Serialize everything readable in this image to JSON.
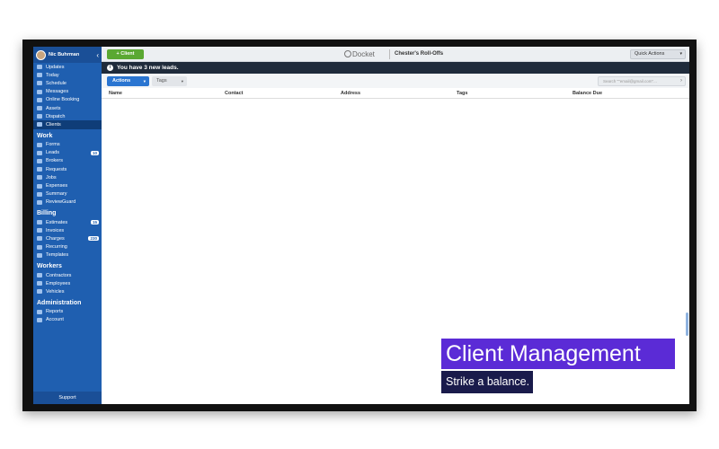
{
  "user": {
    "name": "Nic Buhrman"
  },
  "sidebar": {
    "main": [
      {
        "label": "Updates",
        "icon": "bell-icon"
      },
      {
        "label": "Today",
        "icon": "calendar-icon"
      },
      {
        "label": "Schedule",
        "icon": "calendar-icon"
      },
      {
        "label": "Messages",
        "icon": "chat-icon"
      },
      {
        "label": "Online Booking",
        "icon": "calendar-icon"
      },
      {
        "label": "Assets",
        "icon": "box-icon"
      },
      {
        "label": "Dispatch",
        "icon": "truck-icon"
      },
      {
        "label": "Clients",
        "icon": "users-icon"
      }
    ],
    "work_title": "Work",
    "work": [
      {
        "label": "Forms",
        "badge": ""
      },
      {
        "label": "Leads",
        "badge": "10"
      },
      {
        "label": "Brokers",
        "badge": ""
      },
      {
        "label": "Requests",
        "badge": ""
      },
      {
        "label": "Jobs",
        "badge": ""
      },
      {
        "label": "Expenses",
        "badge": ""
      },
      {
        "label": "Summary",
        "badge": ""
      },
      {
        "label": "ReviewGuard",
        "badge": ""
      }
    ],
    "billing_title": "Billing",
    "billing": [
      {
        "label": "Estimates",
        "badge": "15"
      },
      {
        "label": "Invoices",
        "badge": ""
      },
      {
        "label": "Charges",
        "badge": "230"
      },
      {
        "label": "Recurring",
        "badge": ""
      },
      {
        "label": "Templates",
        "badge": ""
      }
    ],
    "workers_title": "Workers",
    "workers": [
      {
        "label": "Contractors"
      },
      {
        "label": "Employees"
      },
      {
        "label": "Vehicles"
      }
    ],
    "admin_title": "Administration",
    "admin": [
      {
        "label": "Reports"
      },
      {
        "label": "Account"
      }
    ],
    "support": "Support"
  },
  "topbar": {
    "new_client": "+ Client",
    "brand": "Docket",
    "company": "Chester's Roll-Offs",
    "quick_actions": "Quick Actions"
  },
  "banner": {
    "text": "You have 3 new leads."
  },
  "toolbar": {
    "actions": "Actions",
    "tags": "Tags",
    "search_placeholder": "Search \"\"email@gmail.com\"..."
  },
  "table": {
    "headers": {
      "name": "Name",
      "contact": "Contact",
      "address": "Address",
      "tags": "Tags",
      "balance": "Balance Due"
    }
  },
  "colors": {
    "sidebar": "#1f5fb0",
    "accent": "#2a75d1",
    "green": "#5aa832",
    "due": "#c0303c"
  },
  "overlay": {
    "title": "Client Management",
    "subtitle": "Strike a balance."
  }
}
